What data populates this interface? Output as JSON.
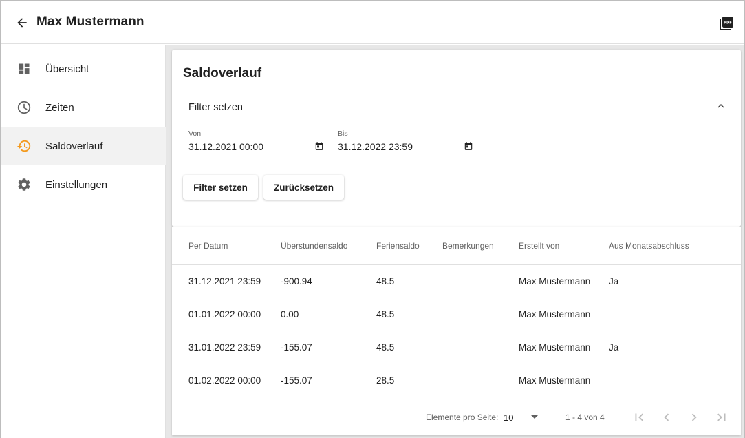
{
  "header": {
    "title": "Max Mustermann",
    "back_icon": "arrow-back-icon",
    "pdf_icon": "pdf-icon"
  },
  "sidebar": {
    "items": [
      {
        "label": "Übersicht",
        "icon": "dashboard-icon",
        "active": false
      },
      {
        "label": "Zeiten",
        "icon": "clock-icon",
        "active": false
      },
      {
        "label": "Saldoverlauf",
        "icon": "history-icon",
        "active": true
      },
      {
        "label": "Einstellungen",
        "icon": "gear-icon",
        "active": false
      }
    ],
    "accent_color": "#f39a1e"
  },
  "filter_card": {
    "title": "Saldoverlauf",
    "filter_heading": "Filter setzen",
    "from": {
      "label": "Von",
      "value": "31.12.2021 00:00"
    },
    "to": {
      "label": "Bis",
      "value": "31.12.2022 23:59"
    },
    "apply_button": "Filter setzen",
    "reset_button": "Zurücksetzen"
  },
  "table": {
    "columns": [
      "Per Datum",
      "Überstundensaldo",
      "Feriensaldo",
      "Bemerkungen",
      "Erstellt von",
      "Aus Monatsabschluss"
    ],
    "rows": [
      [
        "31.12.2021 23:59",
        "-900.94",
        "48.5",
        "",
        "Max Mustermann",
        "Ja"
      ],
      [
        "01.01.2022 00:00",
        "0.00",
        "48.5",
        "",
        "Max Mustermann",
        ""
      ],
      [
        "31.01.2022 23:59",
        "-155.07",
        "48.5",
        "",
        "Max Mustermann",
        "Ja"
      ],
      [
        "01.02.2022 00:00",
        "-155.07",
        "28.5",
        "",
        "Max Mustermann",
        ""
      ]
    ]
  },
  "paginator": {
    "label": "Elemente pro Seite:",
    "page_size": "10",
    "range": "1 - 4 von 4"
  }
}
